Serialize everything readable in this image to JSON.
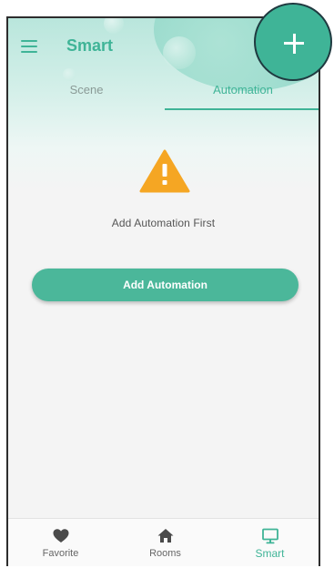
{
  "header": {
    "title": "Smart",
    "menu_icon": "hamburger-menu-icon",
    "add_icon": "plus-icon"
  },
  "tabs": [
    {
      "label": "Scene",
      "active": false
    },
    {
      "label": "Automation",
      "active": true
    }
  ],
  "empty_state": {
    "icon": "warning-triangle-icon",
    "message": "Add Automation First",
    "button_label": "Add Automation"
  },
  "bottom_nav": [
    {
      "label": "Favorite",
      "icon": "heart-icon",
      "active": false
    },
    {
      "label": "Rooms",
      "icon": "home-icon",
      "active": false
    },
    {
      "label": "Smart",
      "icon": "monitor-icon",
      "active": true
    }
  ],
  "colors": {
    "accent": "#3fb497",
    "warning": "#f5a623",
    "button": "#4bb79a"
  }
}
